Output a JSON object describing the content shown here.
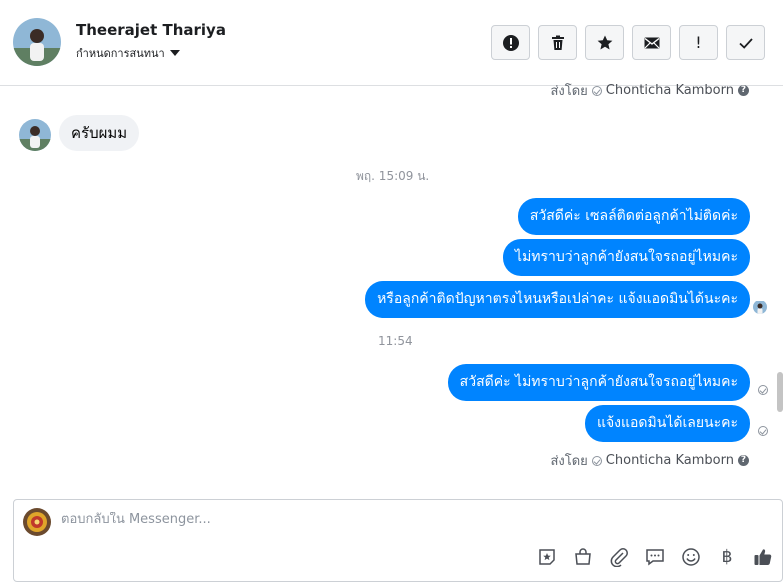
{
  "header": {
    "contact_name": "Theerajet Thariya",
    "label_menu": "กำหนดการสนทนา",
    "actions": [
      {
        "icon": "exclamation-circle-icon"
      },
      {
        "icon": "trash-icon"
      },
      {
        "icon": "star-icon"
      },
      {
        "icon": "envelope-icon"
      },
      {
        "icon": "exclamation-icon",
        "glyph": "!"
      },
      {
        "icon": "checkmark-icon"
      }
    ]
  },
  "thread": {
    "top_sent_by": {
      "prefix": "ส่งโดย",
      "name": "Chonticha Kamborn",
      "help": "?"
    },
    "incoming": {
      "text": "ครับผมม"
    },
    "timestamp1": "พฤ. 15:09 น.",
    "outgoing_group1": [
      "สวัสดีค่ะ เซลล์ติดต่อลูกค้าไม่ติดค่ะ",
      "ไม่ทราบว่าลูกค้ายังสนใจรถอยู่ไหมคะ",
      "หรือลูกค้าติดปัญหาตรงไหนหรือเปล่าคะ แจ้งแอดมินได้นะคะ"
    ],
    "timestamp2": "11:54",
    "outgoing_group2": [
      "สวัสดีค่ะ ไม่ทราบว่าลูกค้ายังสนใจรถอยู่ไหมคะ",
      "แจ้งแอดมินได้เลยนะคะ"
    ],
    "bottom_sent_by": {
      "prefix": "ส่งโดย",
      "name": "Chonticha Kamborn",
      "help": "?"
    }
  },
  "composer": {
    "placeholder": "ตอบกลับใน Messenger...",
    "tools": [
      {
        "icon": "sticker-star-icon"
      },
      {
        "icon": "shopping-bag-icon"
      },
      {
        "icon": "paperclip-icon"
      },
      {
        "icon": "saved-reply-icon"
      },
      {
        "icon": "emoji-icon"
      },
      {
        "icon": "baht-icon",
        "glyph": "฿"
      },
      {
        "icon": "thumbs-up-icon"
      }
    ]
  },
  "colors": {
    "outgoing_bubble": "#0084ff",
    "incoming_bubble": "#f0f2f5",
    "accent_icon": "#4b4f56"
  }
}
